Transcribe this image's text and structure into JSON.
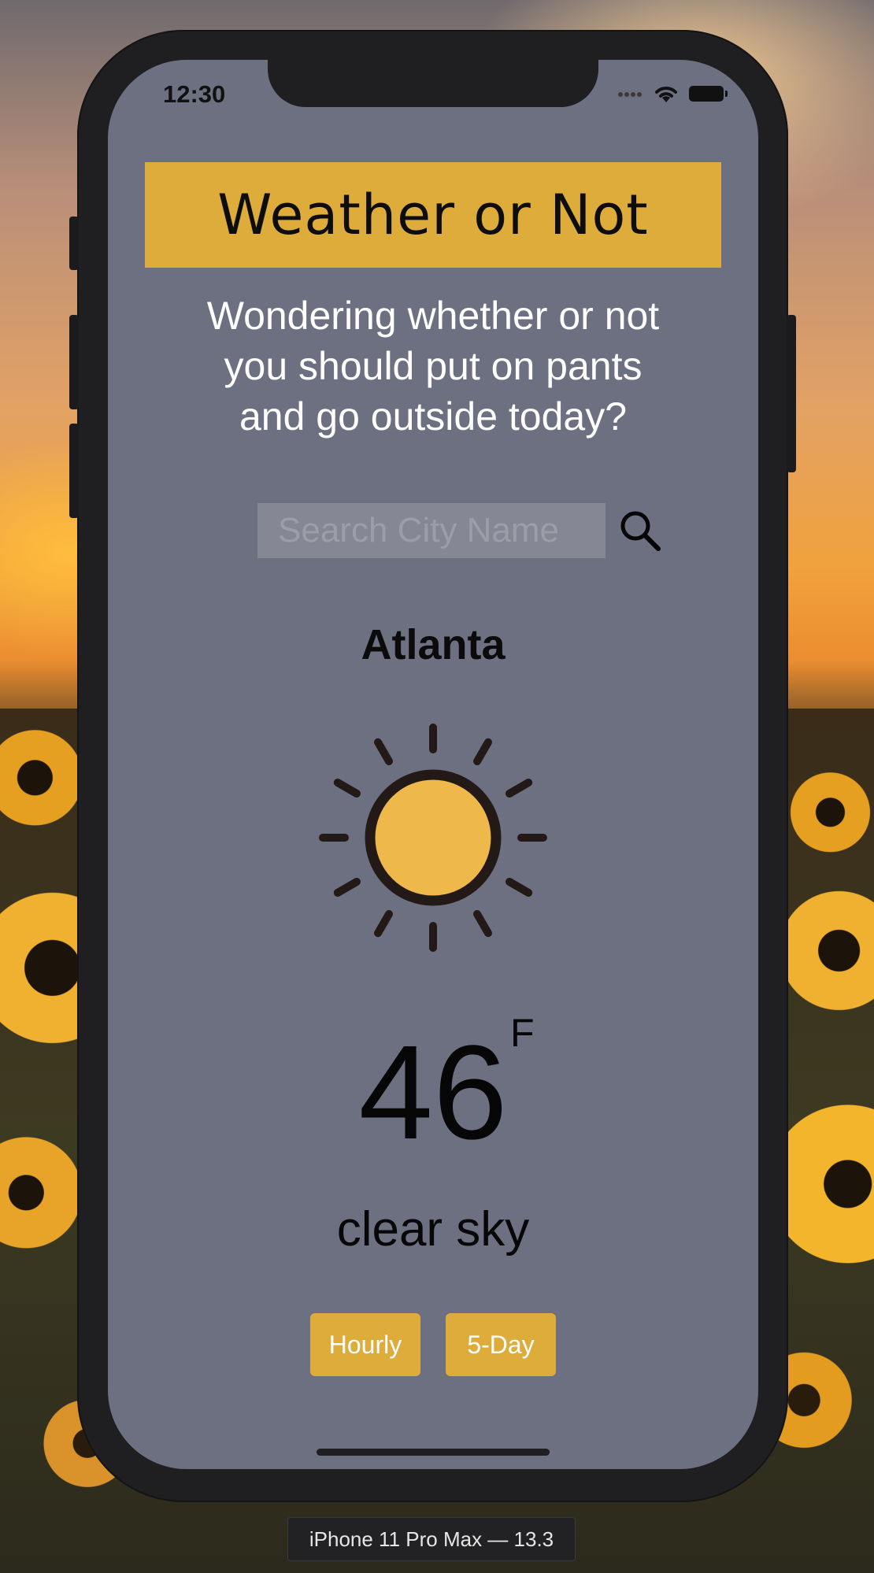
{
  "status_bar": {
    "time": "12:30"
  },
  "app": {
    "title": "Weather or Not",
    "tagline_lines": [
      "Wondering whether or not",
      "you should put on pants",
      "and go outside today?"
    ]
  },
  "search": {
    "placeholder": "Search City Name",
    "value": ""
  },
  "weather": {
    "city": "Atlanta",
    "icon": "sun-icon",
    "temperature": "46",
    "unit": "F",
    "description": "clear sky"
  },
  "buttons": {
    "hourly": "Hourly",
    "five_day": "5-Day"
  },
  "simulator": {
    "device_label": "iPhone 11 Pro Max — 13.3"
  },
  "colors": {
    "accent": "#ddac3b",
    "screen_background": "#6d7080",
    "sun_fill": "#eeb84a",
    "sun_outline": "#231a18"
  }
}
